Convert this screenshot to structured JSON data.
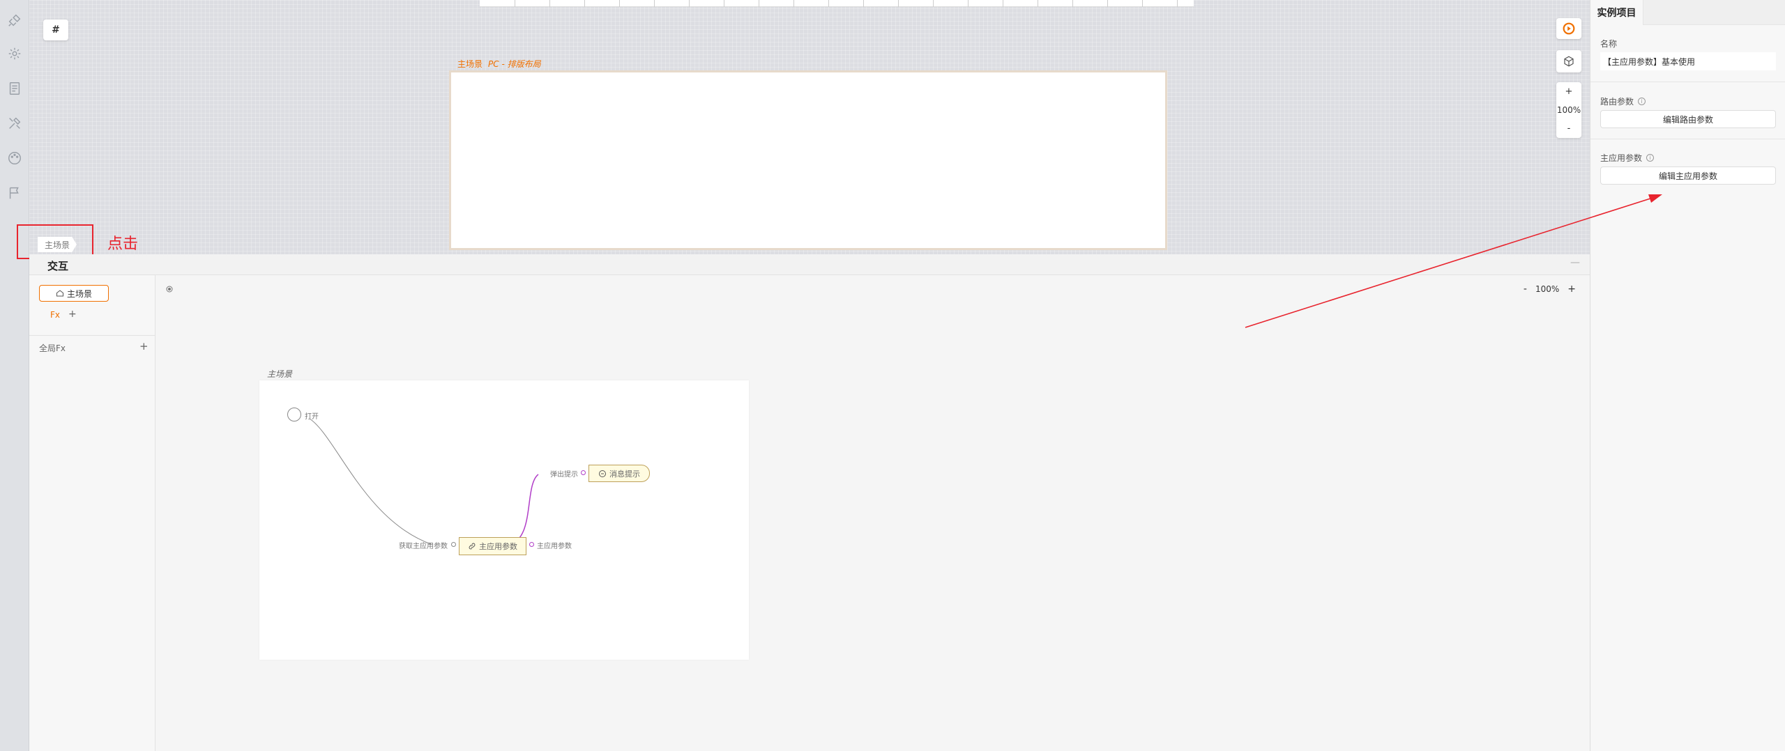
{
  "canvas": {
    "hash_label": "#",
    "scene_label": "主场景",
    "scene_sublabel": "PC - 排版布局",
    "zoom_in": "+",
    "zoom_level": "100%",
    "zoom_out": "-",
    "bottom_tab": "主场景"
  },
  "annotation": {
    "click_label": "点击",
    "color": "#e8242e"
  },
  "interaction": {
    "title": "交互",
    "collapse": "—",
    "scene_chip": "主场景",
    "fx_label": "Fx",
    "fx_add": "+",
    "global_fx": "全局Fx",
    "global_fx_add": "+",
    "zoom_out": "-",
    "zoom_level": "100%",
    "zoom_in": "+",
    "scene_card_label": "主场景",
    "open_label": "打开",
    "get_params_label": "获取主应用参数",
    "main_node_label": "主应用参数",
    "output_label": "主应用参数",
    "popup_label": "弹出提示",
    "message_node_label": "消息提示"
  },
  "right_panel": {
    "tab": "实例项目",
    "name_label": "名称",
    "name_value": "【主应用参数】基本使用",
    "route_label": "路由参数",
    "route_button": "编辑路由参数",
    "app_params_label": "主应用参数",
    "app_params_button": "编辑主应用参数"
  },
  "colors": {
    "accent": "#f07000",
    "annotation_red": "#e8242e",
    "node_fill": "#fffbe0",
    "wire_purple": "#b13ec8"
  },
  "icons": [
    "plugin-icon",
    "settings-icon",
    "pages-icon",
    "tools-icon",
    "theme-icon",
    "flag-icon",
    "locate-icon",
    "scene-home-icon",
    "link-icon",
    "message-icon",
    "cube-icon",
    "debug-icon",
    "info-icon"
  ]
}
